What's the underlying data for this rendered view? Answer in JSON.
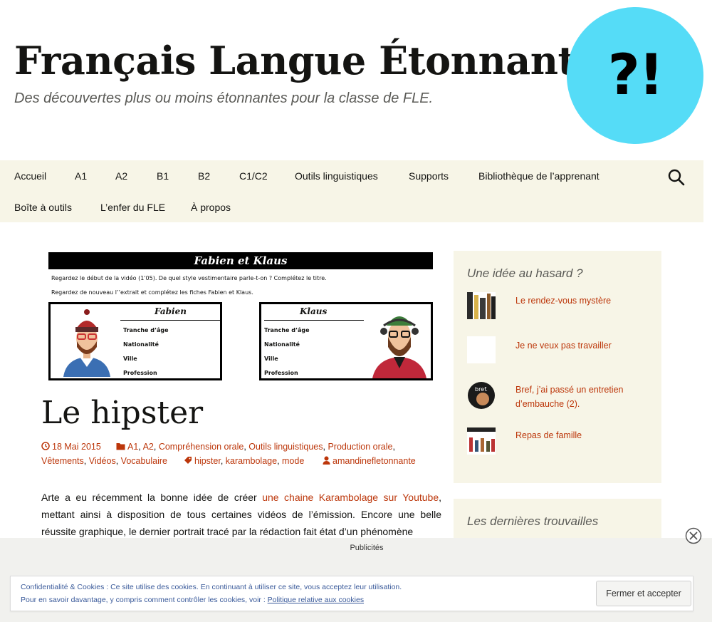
{
  "header": {
    "site_title": "Français Langue Étonnante",
    "tagline": "Des découvertes plus ou moins étonnantes pour la classe de FLE.",
    "logo_text": "?!"
  },
  "nav": {
    "row1": [
      "Accueil",
      "A1",
      "A2",
      "B1",
      "B2",
      "C1/C2",
      "Outils linguistiques",
      "Supports",
      "Bibliothèque de l’apprenant"
    ],
    "row2": [
      "Boîte à outils",
      "L’enfer du FLE",
      "À propos"
    ]
  },
  "featured": {
    "banner": "Fabien et Klaus",
    "line1": "Regardez le début de la vidéo (1'05). De quel style vestimentaire parle-t-on ? Complétez le titre.",
    "line2": "Regardez de nouveau l’’extrait et complétez les fiches Fabien et Klaus.",
    "card_left_title": "Fabien",
    "card_right_title": "Klaus",
    "fields": [
      "Tranche d’âge",
      "Nationalité",
      "Ville",
      "Profession"
    ]
  },
  "post": {
    "title": "Le hipster",
    "date": "18 Mai 2015",
    "categories": [
      "A1",
      "A2",
      "Compréhension orale",
      "Outils linguistiques",
      "Production orale",
      "Vêtements",
      "Vidéos",
      "Vocabulaire"
    ],
    "tags": [
      "hipster",
      "karambolage",
      "mode"
    ],
    "author": "amandinefletonnante",
    "body_before_link": "Arte a eu récemment la bonne idée de créer ",
    "body_link": "une chaine Karambolage sur Youtube",
    "body_after_link": ", mettant ainsi à disposition de tous certaines vidéos de l’émission. Encore une belle réussite graphique, le dernier portrait tracé par la rédaction fait état d’un phénomène"
  },
  "sidebar": {
    "random_title": "Une idée au hasard ?",
    "random_items": [
      "Le rendez-vous mystère",
      "Je ne veux pas travailler",
      "Bref, j’ai passé un entretien d’embauche (2).",
      "Repas de famille"
    ],
    "latest_title": "Les dernières trouvailles"
  },
  "ad": {
    "label": "Publicités"
  },
  "cookie": {
    "line1": "Confidentialité & Cookies : Ce site utilise des cookies. En continuant à utiliser ce site, vous acceptez leur utilisation.",
    "line2_prefix": "Pour en savoir davantage, y compris comment contrôler les cookies, voir : ",
    "line2_link": "Politique relative aux cookies",
    "button": "Fermer et accepter"
  },
  "colors": {
    "accent": "#bc360a",
    "nav_bg": "#f7f5e7",
    "logo": "#55dcf7"
  }
}
